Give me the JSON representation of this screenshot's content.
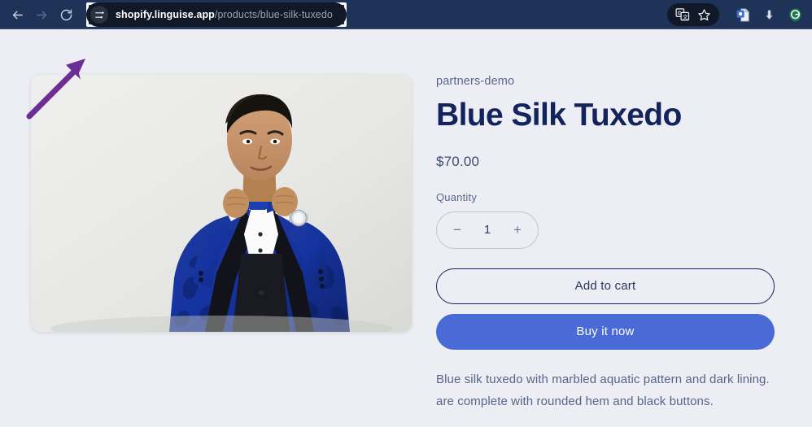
{
  "browser": {
    "nav": {
      "back_icon": "arrow-left-icon",
      "forward_icon": "arrow-right-icon",
      "reload_icon": "reload-icon"
    },
    "address_bar": {
      "site_settings_icon": "tune-sliders-icon",
      "url_host": "shopify.linguise.app",
      "url_path": "/products/blue-silk-tuxedo",
      "full_url": "shopify.linguise.app/products/blue-silk-tuxedo",
      "highlight_color": "#ffffff"
    },
    "toolbar_icons": [
      {
        "name": "google-translate-icon",
        "label": "Translate this page"
      },
      {
        "name": "bookmark-star-icon",
        "label": "Bookmark this tab"
      },
      {
        "name": "extension-document-icon",
        "label": "Extension"
      },
      {
        "name": "download-icon",
        "label": "Downloads"
      },
      {
        "name": "grammarly-icon",
        "label": "Grammarly"
      }
    ],
    "chrome_color": "#1f3257"
  },
  "annotation": {
    "arrow_color": "#6b2d96",
    "arrow_name": "purple-pointer-arrow",
    "points_to": "address-bar"
  },
  "product": {
    "image_alt": "Man wearing blue silk tuxedo adjusting bow tie",
    "vendor": "partners-demo",
    "title": "Blue Silk Tuxedo",
    "price": "$70.00",
    "quantity": {
      "label": "Quantity",
      "decrease": "−",
      "value": "1",
      "increase": "+"
    },
    "buttons": {
      "add_to_cart": "Add to cart",
      "buy_it_now": "Buy it now"
    },
    "description_line_1": "Blue silk tuxedo with marbled aquatic pattern and dark lining.",
    "description_line_2": "are complete with rounded hem and black buttons."
  },
  "colors": {
    "page_background": "#eceef4",
    "title": "#13235c",
    "accent_blue": "#4a6ad6",
    "muted_text": "#5c6788"
  }
}
